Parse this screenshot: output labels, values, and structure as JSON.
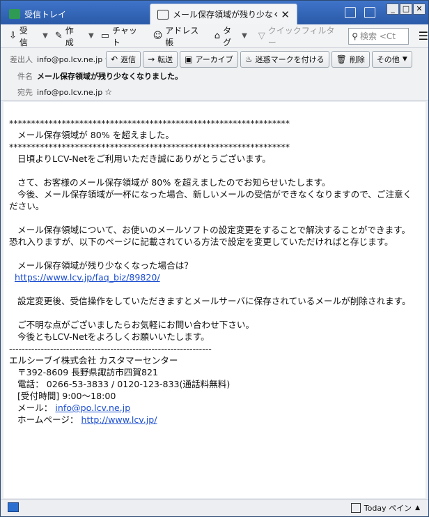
{
  "tabs": [
    {
      "label": "受信トレイ",
      "icon": "inbox-icon"
    },
    {
      "label": "メール保存領域が残り少なくな",
      "icon": "envelope-icon"
    }
  ],
  "window_controls": {
    "minimize": "_",
    "maximize": "□",
    "close": "✕"
  },
  "toolbar": {
    "get_mail": "受信",
    "write": "作成",
    "chat": "チャット",
    "address_book": "アドレス帳",
    "tag": "タグ",
    "quick_filter": "クイックフィルター",
    "search_placeholder": "検索 <Ct"
  },
  "header": {
    "from_label": "差出人",
    "from_value": "info@po.lcv.ne.jp",
    "subject_label": "件名",
    "subject_value": "メール保存領域が残り少なくなりました。",
    "to_label": "宛先",
    "to_value": "info@po.lcv.ne.jp",
    "actions": {
      "reply": "返信",
      "forward": "転送",
      "archive": "アーカイブ",
      "junk": "迷惑マークを付ける",
      "delete": "削除",
      "other": "その他"
    }
  },
  "body": {
    "stars1": "****************************************************************",
    "headline": "   メール保存領域が 80% を超えました。",
    "stars2": "****************************************************************",
    "p1": "\n   日頃よりLCV-Netをご利用いただき誠にありがとうございます。\n\n   さて、お客様のメール保存領域が 80% を超えましたのでお知らせいたします。\n   今後、メール保存領域が一杯になった場合、新しいメールの受信ができなくなりますので、ご注意ください。\n\n   メール保存領域について、お使いのメールソフトの設定変更をすることで解決することができます。恐れ入りますが、以下のページに記載されている方法で設定を変更していただければと存じます。\n\n   メール保存領域が残り少なくなった場合は？\n  ",
    "link1": "https://www.lcv.jp/faq_biz/89820/",
    "p2": "\n\n   設定変更後、受信操作をしていただきますとメールサーバに保存されているメールが削除されます。\n\n   ご不明な点がございましたらお気軽にお問い合わせ下さい。\n   今後ともLCV-Netをよろしくお願いいたします。\n",
    "divider": "----------------------------------------------------------------",
    "company": "エルシーブイ株式会社 カスタマーセンター",
    "address": "   〒392-8609 長野県諏訪市四賀821",
    "phone": "   電話： 0266-53-3833 / 0120-123-833(通話料無料)",
    "hours": "   [受付時間] 9:00～18:00",
    "mail_label": "   メール： ",
    "mail_link": "info@po.lcv.ne.jp",
    "home_label": "   ホームページ： ",
    "home_link": "http://www.lcv.jp/"
  },
  "status": {
    "today_pane": "Today ペイン"
  }
}
